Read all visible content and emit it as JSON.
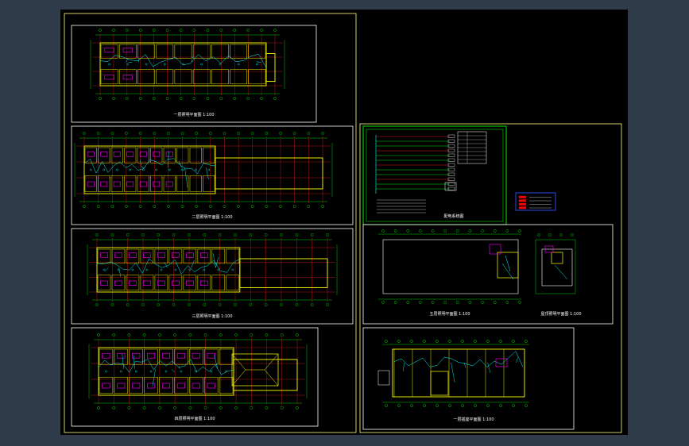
{
  "drawing": {
    "colors": {
      "background_outer": "#2f3b49",
      "canvas": "#000000",
      "frame": "#ffff80",
      "sheet_border": "#ffffff",
      "grid_axis": "#ff2020",
      "wall": "#ffff00",
      "wiring": "#00ffff",
      "dimension": "#00ff00",
      "room_accent": "#ff00ff",
      "legend_frame": "#00ff00",
      "symbol_box": "#3050ff",
      "symbol_fill": "#ff0000"
    },
    "sheets": [
      {
        "id": "sheet-1",
        "label": "一层照明平面图 1:100"
      },
      {
        "id": "sheet-2",
        "label": "二层照明平面图 1:100"
      },
      {
        "id": "sheet-3",
        "label": "三层照明平面图 1:100"
      },
      {
        "id": "sheet-4",
        "label": "四层照明平面图 1:100"
      },
      {
        "id": "sheet-5",
        "label": "配电系统图"
      },
      {
        "id": "sheet-6",
        "label": "五层照明平面图 1:100"
      },
      {
        "id": "sheet-7",
        "label": "屋顶照明平面图 1:100"
      },
      {
        "id": "sheet-8",
        "label": "一层插座平面图 1:100"
      }
    ]
  }
}
